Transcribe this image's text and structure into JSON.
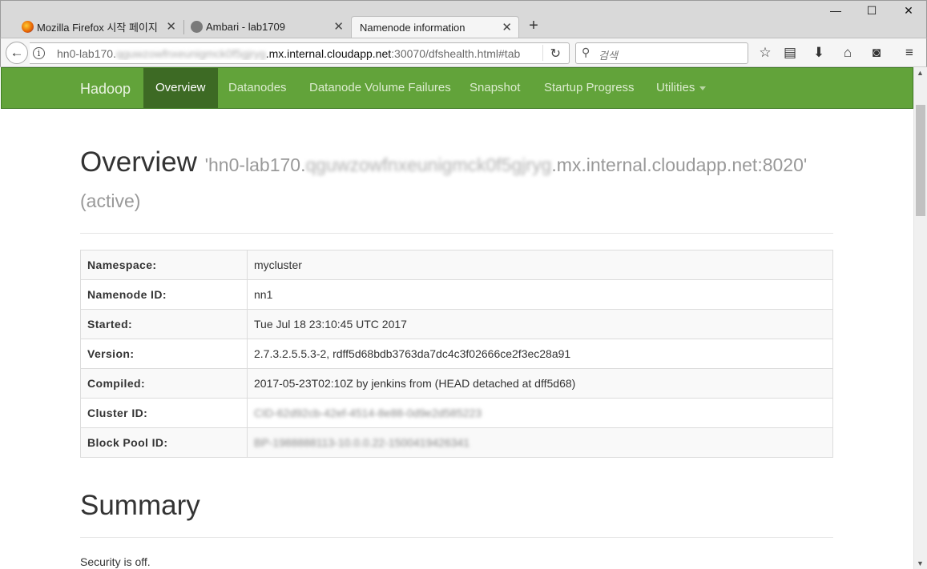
{
  "browser": {
    "tabs": [
      {
        "title": "Mozilla Firefox 시작 페이지",
        "close": "✕"
      },
      {
        "title": "Ambari - lab1709",
        "close": "✕"
      },
      {
        "title": "Namenode information",
        "close": "✕"
      }
    ],
    "newtab": "+",
    "win_minimize": "—",
    "win_maximize": "☐",
    "win_close": "✕",
    "url_prefix": "hn0-lab170.",
    "url_blurred": "qguwzowfnxeunigmck0f5gjryg",
    "url_host": ".mx.internal.cloudapp.net",
    "url_suffix": ":30070/dfshealth.html#tab",
    "search_placeholder": "검색"
  },
  "nav": {
    "brand": "Hadoop",
    "items": [
      "Overview",
      "Datanodes",
      "Datanode Volume Failures",
      "Snapshot",
      "Startup Progress",
      "Utilities"
    ]
  },
  "overview": {
    "title": "Overview",
    "host_prefix": "'hn0-lab170.",
    "host_blurred": "qguwzowfnxeunigmck0f5gjryg",
    "host_suffix": ".mx.internal.cloudapp.net:8020'",
    "state": "(active)",
    "rows": [
      {
        "key": "Namespace:",
        "value": "mycluster"
      },
      {
        "key": "Namenode ID:",
        "value": "nn1"
      },
      {
        "key": "Started:",
        "value": "Tue Jul 18 23:10:45 UTC 2017"
      },
      {
        "key": "Version:",
        "value": "2.7.3.2.5.5.3-2, rdff5d68bdb3763da7dc4c3f02666ce2f3ec28a91"
      },
      {
        "key": "Compiled:",
        "value": "2017-05-23T02:10Z by jenkins from (HEAD detached at dff5d68)"
      },
      {
        "key": "Cluster ID:",
        "value": "CID-62d92cb-42ef-4514-8e88-0d9e2d585223"
      },
      {
        "key": "Block Pool ID:",
        "value": "BP-1988888113-10.0.0.22-1500419426341"
      }
    ]
  },
  "summary": {
    "title": "Summary",
    "security": "Security is off."
  },
  "colors": {
    "navbar": "#62a33a",
    "nav_active": "#3d6a24"
  }
}
